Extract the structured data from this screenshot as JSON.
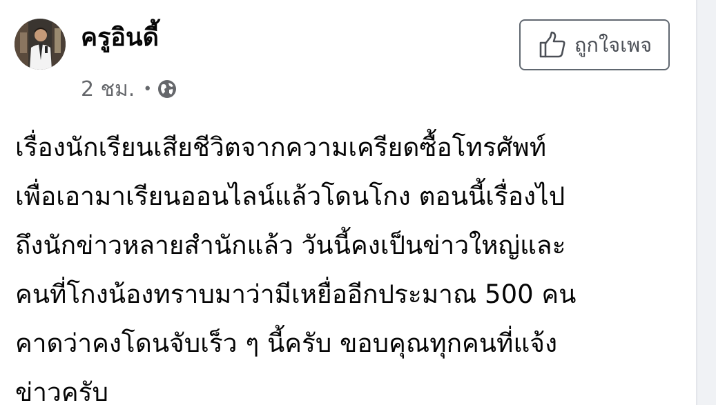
{
  "post": {
    "author": "ครูอินดี้",
    "time": "2 ชม.",
    "separator": "•",
    "privacy_icon": "globe-icon",
    "like_page_label": "ถูกใจเพจ",
    "like_page_icon": "thumbs-up-icon",
    "avatar_icon": "avatar-photo",
    "lines": [
      "เรื่องนักเรียนเสียชีวิตจากความเครียดซื้อโทรศัพท์",
      "เพื่อเอามาเรียนออนไลน์แล้วโดนโกง ตอนนี้เรื่องไป",
      "ถึงนักข่าวหลายสำนักแล้ว วันนี้คงเป็นข่าวใหญ่และ",
      "คนที่โกงน้องทราบมาว่ามีเหยื่ออีกประมาณ 500 คน",
      "คาดว่าคงโดนจับเร็ว ๆ นี้ครับ ขอบคุณทุกคนที่แจ้ง",
      "ข่าวครับ"
    ]
  },
  "colors": {
    "text": "#050505",
    "secondary_text": "#65676b",
    "button_border": "#606770",
    "divider": "#e4e6eb",
    "side_background": "#f0f2f5"
  }
}
